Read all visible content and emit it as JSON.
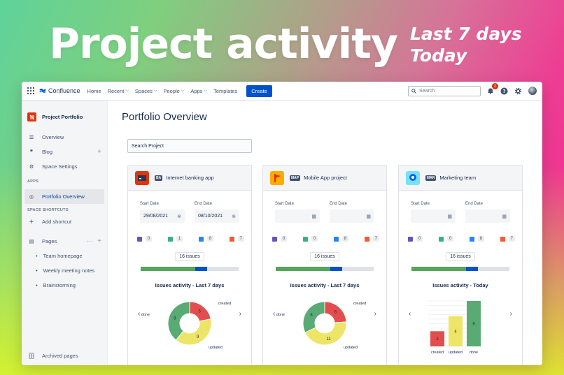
{
  "hero": {
    "title": "Project activity",
    "sub1": "Last 7 days",
    "sub2": "Today"
  },
  "topnav": {
    "brand": "Confluence",
    "items": [
      {
        "label": "Home",
        "dropdown": false
      },
      {
        "label": "Recent",
        "dropdown": true
      },
      {
        "label": "Spaces",
        "dropdown": true
      },
      {
        "label": "People",
        "dropdown": true
      },
      {
        "label": "Apps",
        "dropdown": true
      },
      {
        "label": "Templates",
        "dropdown": false
      }
    ],
    "create": "Create",
    "search_placeholder": "Search",
    "notification_count": "2"
  },
  "sidebar": {
    "space_name": "Project Portfolio",
    "overview": "Overview",
    "blog": "Blog",
    "settings": "Space Settings",
    "apps_label": "APPS",
    "portfolio_overview": "Portfolio Overview",
    "shortcuts_label": "SPACE SHORTCUTS",
    "add_shortcut": "Add shortcut",
    "pages": "Pages",
    "page_items": [
      "Team homepage",
      "Weekly meeting notes",
      "Brainstorming"
    ],
    "archived": "Archived pages"
  },
  "main": {
    "title": "Portfolio Overview",
    "search_placeholder": "Search Project",
    "start_label": "Start Date",
    "end_label": "End Date",
    "cards": [
      {
        "key": "BA",
        "name": "Internet banking app",
        "start": "29/08/2021",
        "end": "08/10/2021",
        "counts": [
          "0",
          "1",
          "8",
          "7"
        ],
        "issues": "16 issues",
        "activity": "Issues activity - Last 7 days",
        "chart_kind": "donut",
        "slices": [
          {
            "label": "created",
            "value": 5
          },
          {
            "label": "updated",
            "value": 9
          },
          {
            "label": "done",
            "value": 9
          }
        ]
      },
      {
        "key": "MAP",
        "name": "Mobile App project",
        "start": "",
        "end": "",
        "counts": [
          "0",
          "0",
          "8",
          "7"
        ],
        "issues": "16 issues",
        "activity": "Issues activity - Last 7 days",
        "chart_kind": "donut",
        "slices": [
          {
            "label": "created",
            "value": 6
          },
          {
            "label": "updated",
            "value": 11
          },
          {
            "label": "done",
            "value": 8
          }
        ]
      },
      {
        "key": "MAR",
        "name": "Marketing team",
        "start": "",
        "end": "",
        "counts": [
          "0",
          "0",
          "8",
          "7"
        ],
        "issues": "16 issues",
        "activity": "Issues activity - Today",
        "chart_kind": "bar",
        "slices": [
          {
            "label": "created",
            "value": 2
          },
          {
            "label": "updated",
            "value": 4
          },
          {
            "label": "done",
            "value": 6
          }
        ]
      }
    ]
  },
  "colors": {
    "created": "#e34d4d",
    "updated": "#ede567",
    "done": "#5aaa74",
    "bar_done": "#57a55a",
    "bar_progress": "#0052cc"
  },
  "progress": {
    "done_fraction": 0.56,
    "inprogress_fraction": 0.12
  }
}
